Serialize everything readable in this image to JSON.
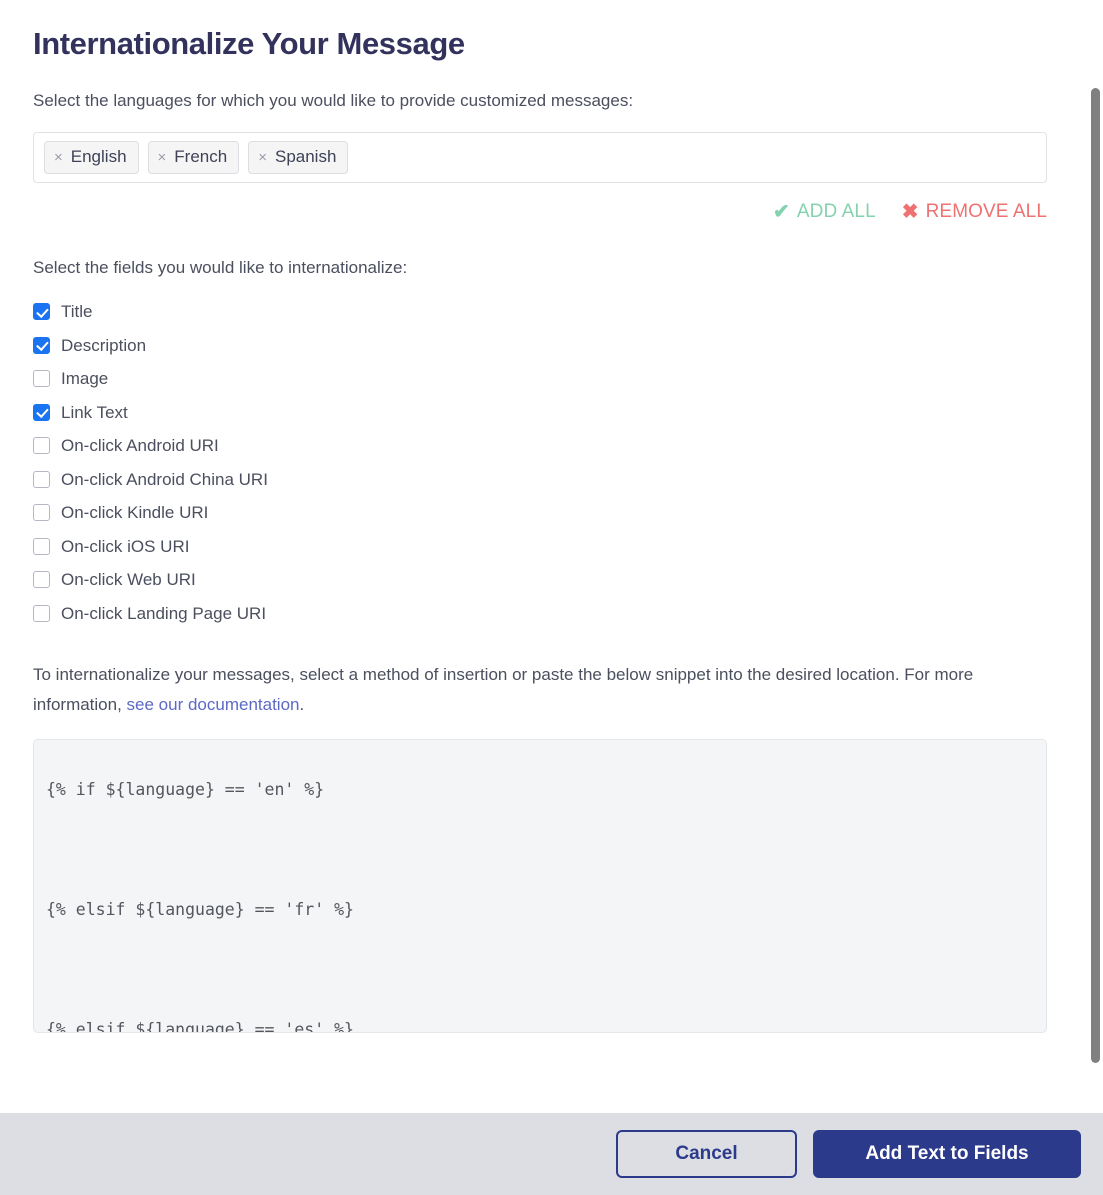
{
  "dialog": {
    "title": "Internationalize Your Message"
  },
  "languages_section": {
    "prompt": "Select the languages for which you would like to provide customized messages:",
    "selected": [
      {
        "label": "English",
        "remove_glyph": "×"
      },
      {
        "label": "French",
        "remove_glyph": "×"
      },
      {
        "label": "Spanish",
        "remove_glyph": "×"
      }
    ],
    "bulk_actions": {
      "add_all": {
        "label": "ADD ALL",
        "glyph": "✔",
        "color": "#84d2ae"
      },
      "remove_all": {
        "label": "REMOVE ALL",
        "glyph": "✖",
        "color": "#ef7171"
      }
    }
  },
  "fields_section": {
    "prompt": "Select the fields you would like to internationalize:",
    "checkbox_color": "#1a73f0",
    "items": [
      {
        "label": "Title",
        "checked": true
      },
      {
        "label": "Description",
        "checked": true
      },
      {
        "label": "Image",
        "checked": false
      },
      {
        "label": "Link Text",
        "checked": true
      },
      {
        "label": "On-click Android URI",
        "checked": false
      },
      {
        "label": "On-click Android China URI",
        "checked": false
      },
      {
        "label": "On-click Kindle URI",
        "checked": false
      },
      {
        "label": "On-click iOS URI",
        "checked": false
      },
      {
        "label": "On-click Web URI",
        "checked": false
      },
      {
        "label": "On-click Landing Page URI",
        "checked": false
      }
    ]
  },
  "instructions": {
    "text_before": "To internationalize your messages, select a method of insertion or paste the below snippet into the desired location. For more information, ",
    "link_text": "see our documentation",
    "text_after": ".",
    "link_color": "#5c6ac4"
  },
  "code_snippet": {
    "content": "{% if ${language} == 'en' %}\n\n{% elsif ${language} == 'fr' %}\n\n{% elsif ${language} == 'es' %}\n\n{% else %}\n\n{% endif %}"
  },
  "footer": {
    "cancel_label": "Cancel",
    "submit_label": "Add Text to Fields",
    "primary_color": "#2c3a8c",
    "background_color": "#dddee3"
  }
}
